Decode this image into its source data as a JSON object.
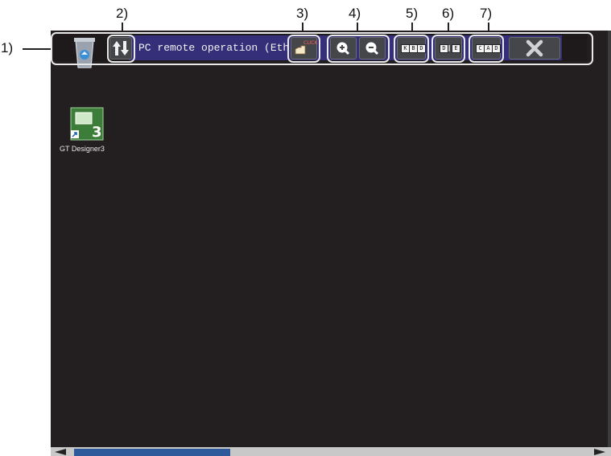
{
  "callouts": {
    "c1": "1)",
    "c2": "2)",
    "c3": "3)",
    "c4": "4)",
    "c5": "5)",
    "c6": "6)",
    "c7": "7)"
  },
  "titlebar": {
    "title": "PC remote operation (Eth..",
    "click_label": "CLICK",
    "kbd_keys": [
      "K",
      "B",
      "D"
    ],
    "de_keys": [
      "D",
      "E"
    ],
    "cad_keys": [
      "C",
      "A",
      "D"
    ]
  },
  "desktop": {
    "icon_label": "GT Designer3"
  },
  "colors": {
    "screen": "#231f20",
    "titlebar_accent": "#352f7a",
    "frame": "#e9e9e9",
    "scroll_thumb": "#2e5a9c"
  }
}
